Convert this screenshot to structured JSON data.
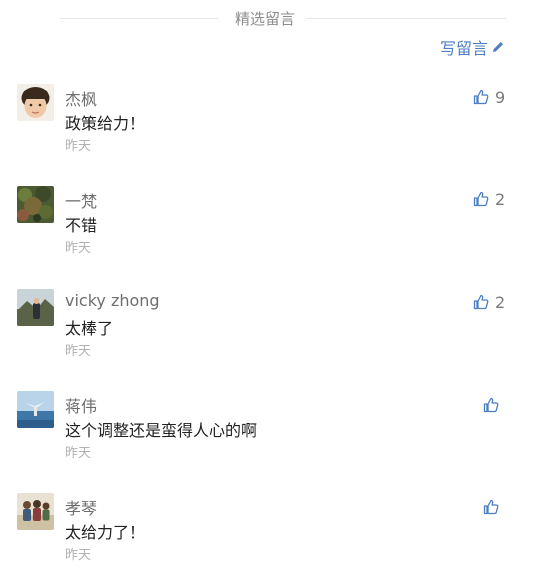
{
  "section": {
    "title": "精选留言"
  },
  "write_comment": {
    "label": "写留言"
  },
  "colors": {
    "accent": "#4b7ec2",
    "muted": "#b2b2b2",
    "text": "#222222"
  },
  "comments": [
    {
      "name": "杰枫",
      "content": "政策给力！",
      "time": "昨天",
      "likes": "9",
      "avatar_icon": "avatar-child-photo"
    },
    {
      "name": "一梵",
      "content": "不错",
      "time": "昨天",
      "likes": "2",
      "avatar_icon": "avatar-foliage-photo"
    },
    {
      "name": "vicky zhong",
      "content": "太棒了",
      "time": "昨天",
      "likes": "2",
      "avatar_icon": "avatar-outdoor-photo"
    },
    {
      "name": "蒋伟",
      "content": "这个调整还是蛮得人心的啊",
      "time": "昨天",
      "likes": "",
      "avatar_icon": "avatar-sea-photo"
    },
    {
      "name": "孝琴",
      "content": "太给力了！",
      "time": "昨天",
      "likes": "",
      "avatar_icon": "avatar-group-photo"
    }
  ]
}
